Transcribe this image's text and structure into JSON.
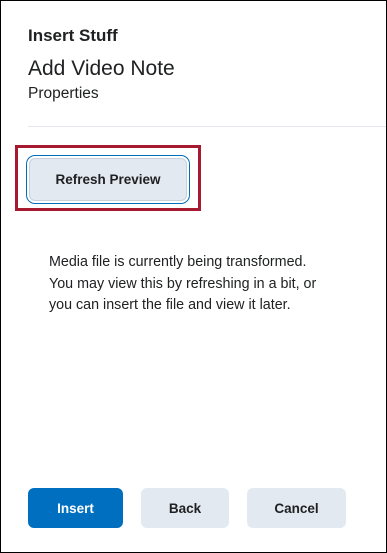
{
  "header": {
    "dialog_title": "Insert Stuff",
    "page_title": "Add Video Note",
    "subtitle": "Properties"
  },
  "preview": {
    "refresh_label": "Refresh Preview",
    "message": "Media file is currently being transformed. You may view this by refreshing in a bit, or you can insert the file and view it later."
  },
  "footer": {
    "insert_label": "Insert",
    "back_label": "Back",
    "cancel_label": "Cancel"
  },
  "colors": {
    "primary": "#006fbf",
    "secondary_button": "#e3e9f1",
    "highlight": "#a6192e"
  }
}
